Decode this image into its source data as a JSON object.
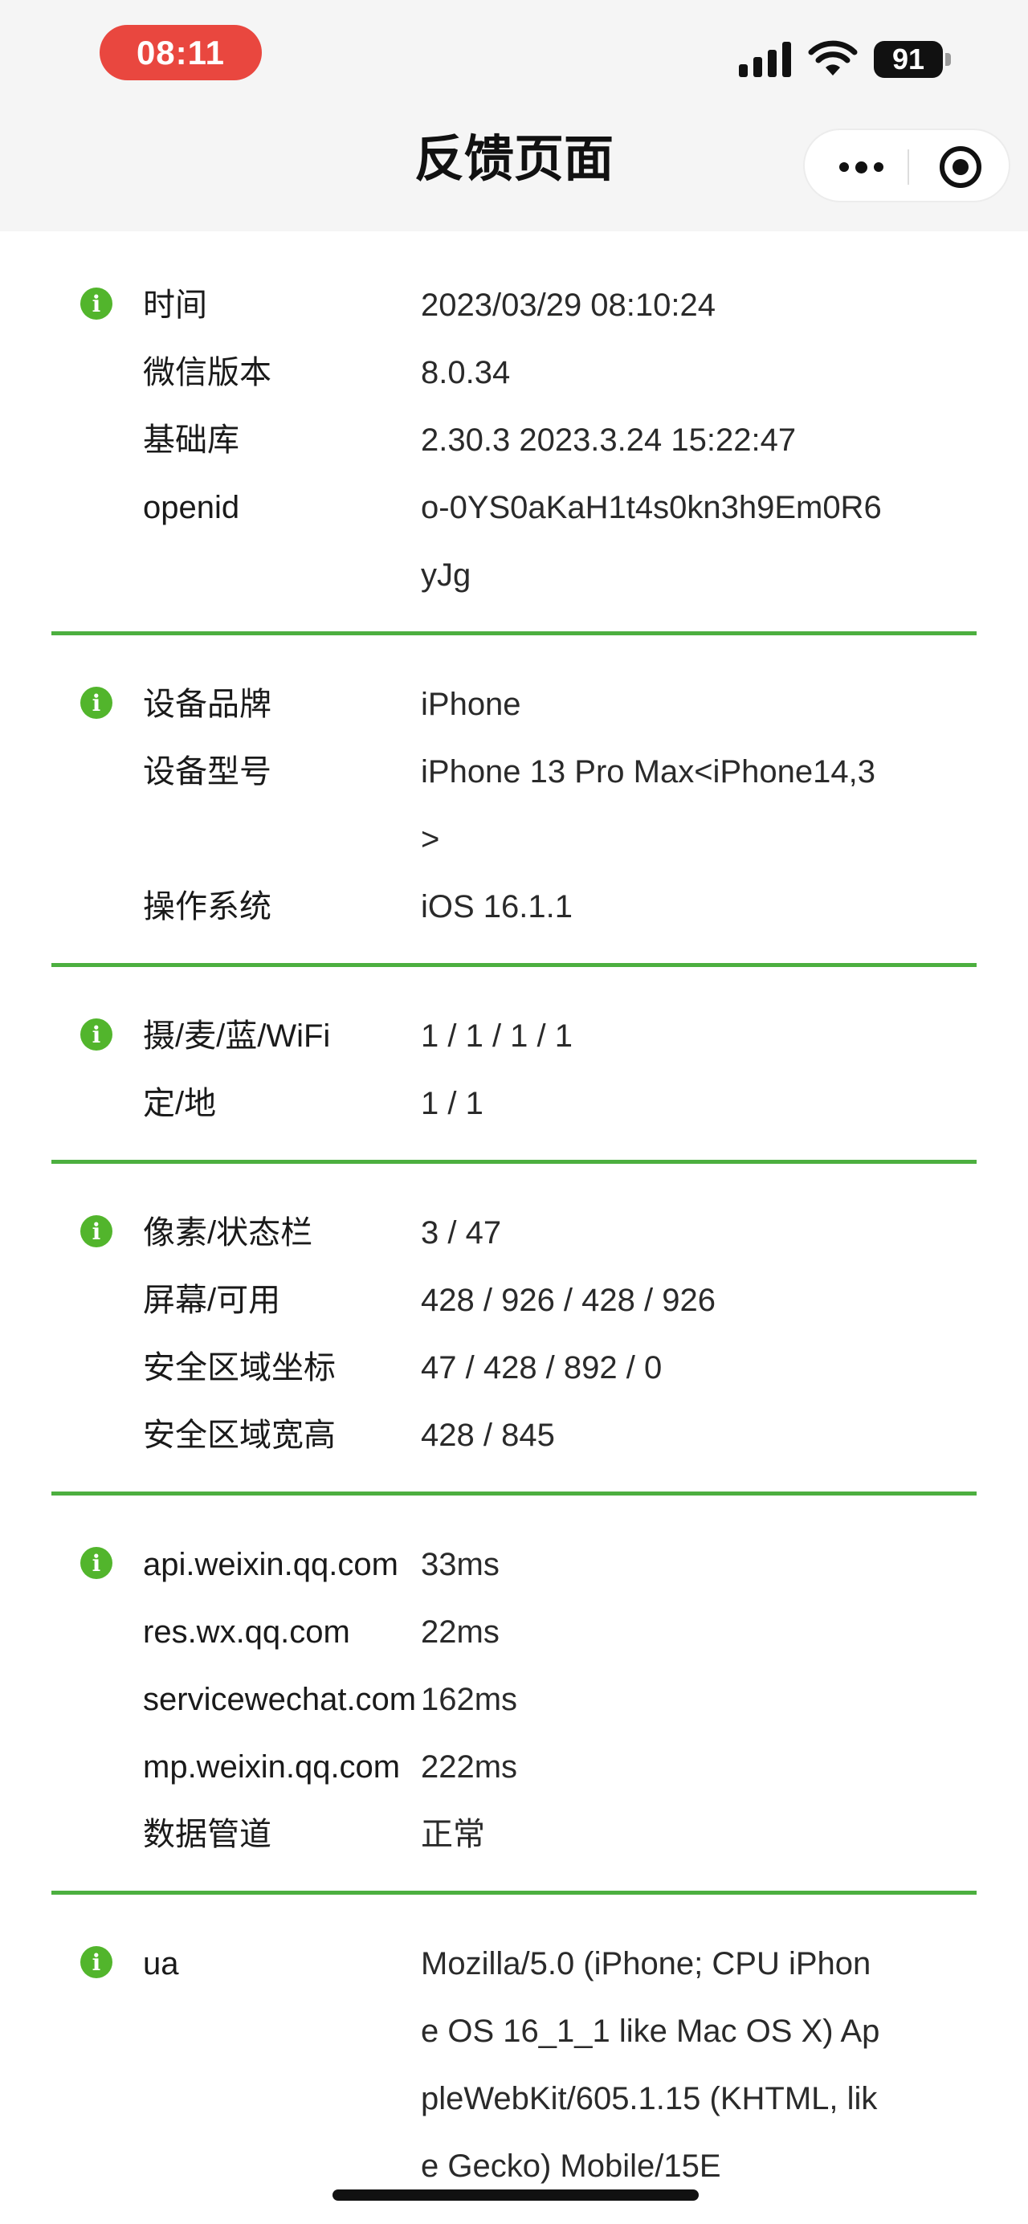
{
  "status_bar": {
    "time": "08:11",
    "battery": "91"
  },
  "nav": {
    "title": "反馈页面"
  },
  "sections": [
    {
      "rows": [
        {
          "label": "时间",
          "value": "2023/03/29 08:10:24"
        },
        {
          "label": "微信版本",
          "value": "8.0.34"
        },
        {
          "label": "基础库",
          "value": "2.30.3 2023.3.24 15:22:47"
        },
        {
          "label": "openid",
          "value": "o-0YS0aKaH1t4s0kn3h9Em0R6yJg"
        }
      ]
    },
    {
      "rows": [
        {
          "label": "设备品牌",
          "value": "iPhone"
        },
        {
          "label": "设备型号",
          "value": "iPhone 13 Pro Max<iPhone14,3>"
        },
        {
          "label": "操作系统",
          "value": "iOS 16.1.1"
        }
      ]
    },
    {
      "rows": [
        {
          "label": "摄/麦/蓝/WiFi",
          "value": "1 / 1 / 1 / 1"
        },
        {
          "label": "定/地",
          "value": "1 / 1"
        }
      ]
    },
    {
      "rows": [
        {
          "label": "像素/状态栏",
          "value": "3 / 47"
        },
        {
          "label": "屏幕/可用",
          "value": "428 / 926 / 428 / 926"
        },
        {
          "label": "安全区域坐标",
          "value": "47 / 428 / 892 / 0"
        },
        {
          "label": "安全区域宽高",
          "value": "428 / 845"
        }
      ]
    },
    {
      "rows": [
        {
          "label": "api.weixin.qq.com",
          "value": "33ms"
        },
        {
          "label": "res.wx.qq.com",
          "value": "22ms"
        },
        {
          "label": "servicewechat.com",
          "value": "162ms"
        },
        {
          "label": "mp.weixin.qq.com",
          "value": "222ms"
        },
        {
          "label": "数据管道",
          "value": "正常"
        }
      ]
    },
    {
      "rows": [
        {
          "label": "ua",
          "value": "Mozilla/5.0 (iPhone; CPU iPhone OS 16_1_1 like Mac OS X) AppleWebKit/605.1.15 (KHTML, like Gecko) Mobile/15E"
        }
      ]
    }
  ],
  "colors": {
    "accent_green": "#4caf3f",
    "time_pill": "#e9473f"
  },
  "icons": {
    "info": "info-icon",
    "more": "more-dots-icon",
    "close": "close-circle-icon"
  }
}
